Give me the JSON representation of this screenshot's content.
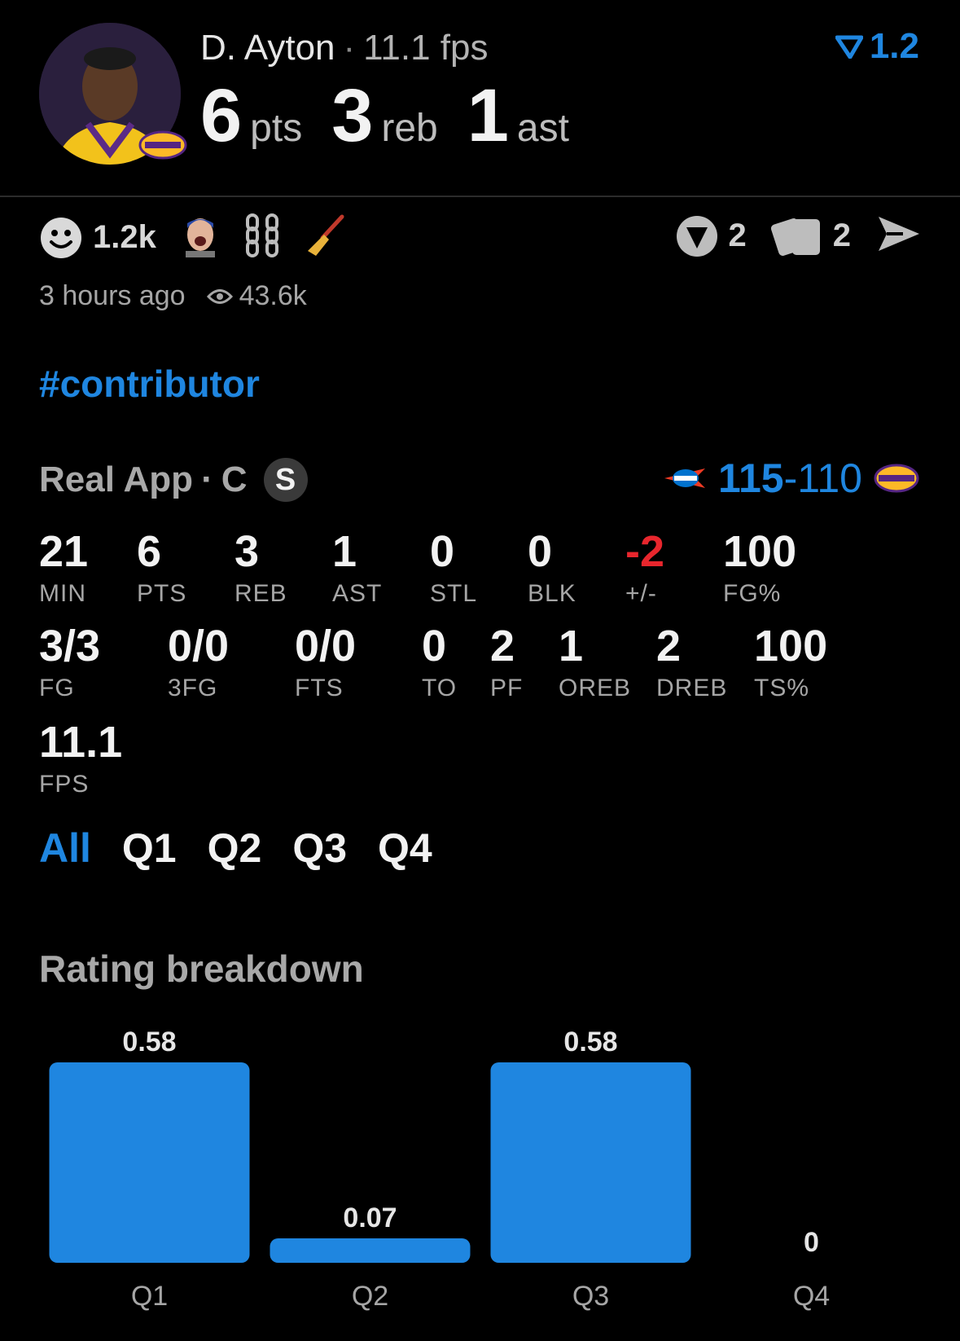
{
  "header": {
    "player_name": "D. Ayton",
    "fps_label": "11.1 fps",
    "rating_value": "1.2",
    "statline": [
      {
        "value": "6",
        "unit": "pts"
      },
      {
        "value": "3",
        "unit": "reb"
      },
      {
        "value": "1",
        "unit": "ast"
      }
    ]
  },
  "reactions": {
    "reaction_count": "1.2k",
    "time_ago": "3 hours ago",
    "views": "43.6k",
    "right": {
      "predictions_count": "2",
      "cards_count": "2"
    }
  },
  "hashtag": "#contributor",
  "game": {
    "source": "Real App",
    "separator": "·",
    "position": "C",
    "starter_badge": "S",
    "home_score": "115",
    "score_dash": "-",
    "away_score": "110"
  },
  "stats_row1": [
    {
      "value": "21",
      "label": "MIN"
    },
    {
      "value": "6",
      "label": "PTS"
    },
    {
      "value": "3",
      "label": "REB"
    },
    {
      "value": "1",
      "label": "AST"
    },
    {
      "value": "0",
      "label": "STL"
    },
    {
      "value": "0",
      "label": "BLK"
    },
    {
      "value": "-2",
      "label": "+/-"
    },
    {
      "value": "100",
      "label": "FG%"
    }
  ],
  "stats_row2": [
    {
      "value": "3/3",
      "label": "FG"
    },
    {
      "value": "0/0",
      "label": "3FG"
    },
    {
      "value": "0/0",
      "label": "FTS"
    },
    {
      "value": "0",
      "label": "TO"
    },
    {
      "value": "2",
      "label": "PF"
    },
    {
      "value": "1",
      "label": "OREB"
    },
    {
      "value": "2",
      "label": "DREB"
    },
    {
      "value": "100",
      "label": "TS%"
    }
  ],
  "stats_row3": [
    {
      "value": "11.1",
      "label": "FPS"
    }
  ],
  "tabs": [
    "All",
    "Q1",
    "Q2",
    "Q3",
    "Q4"
  ],
  "active_tab": "All",
  "rating_section_title": "Rating breakdown",
  "colors": {
    "accent": "#1f86e0",
    "negative": "#e8262d",
    "background": "#000000"
  },
  "chart_data": {
    "type": "bar",
    "categories": [
      "Q1",
      "Q2",
      "Q3",
      "Q4"
    ],
    "values": [
      0.58,
      0.07,
      0.58,
      0
    ],
    "value_labels": [
      "0.58",
      "0.07",
      "0.58",
      "0"
    ],
    "title": "Rating breakdown",
    "ylim": [
      0,
      0.58
    ],
    "grid": false,
    "color": "#1f86e0"
  }
}
